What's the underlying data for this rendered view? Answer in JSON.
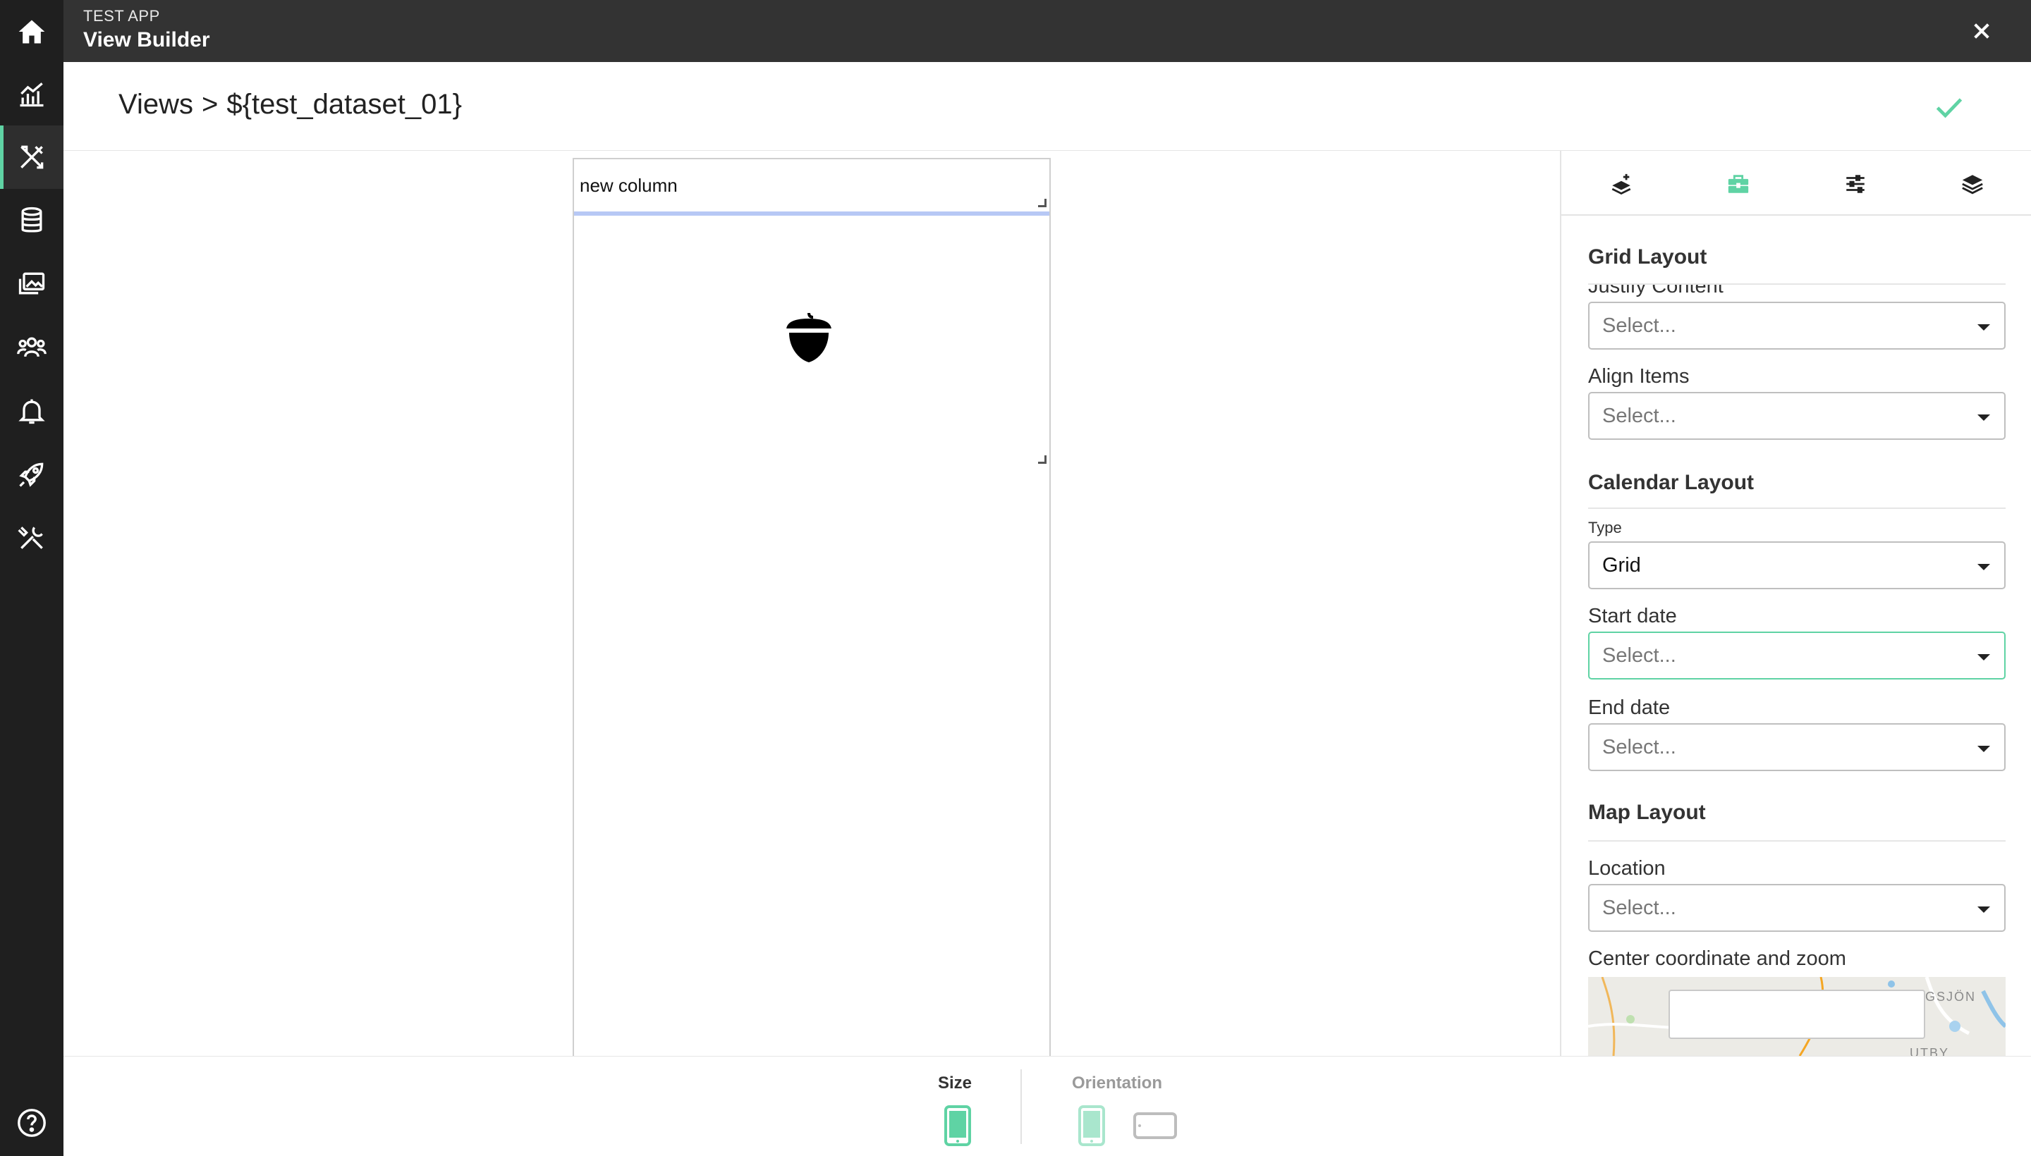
{
  "app": {
    "name": "TEST APP",
    "title": "View Builder"
  },
  "breadcrumb": {
    "root": "Views",
    "separator": ">",
    "current": "${test_dataset_01}"
  },
  "canvas": {
    "column_label": "new column"
  },
  "bottom_bar": {
    "size_label": "Size",
    "orientation_label": "Orientation"
  },
  "panel": {
    "tabs": [
      "layer-add-icon",
      "toolbox-icon",
      "sliders-icon",
      "layers-icon"
    ],
    "grid_layout": {
      "title": "Grid Layout",
      "justify_content_label": "Justify Content",
      "justify_content_value": "Select...",
      "align_items_label": "Align Items",
      "align_items_value": "Select..."
    },
    "calendar_layout": {
      "title": "Calendar Layout",
      "type_label": "Type",
      "type_value": "Grid",
      "start_date_label": "Start date",
      "start_date_value": "Select...",
      "end_date_label": "End date",
      "end_date_value": "Select..."
    },
    "map_layout": {
      "title": "Map Layout",
      "location_label": "Location",
      "location_value": "Select...",
      "center_label": "Center coordinate and zoom",
      "map_text_1": "GSJÖN",
      "map_text_2": "UTBY"
    }
  },
  "colors": {
    "accent": "#5fd3a4",
    "nav_bg": "#1f1f1f",
    "topbar_bg": "#333333",
    "column_underline": "#b7c8f5"
  },
  "nav_icons": [
    "home-icon",
    "analytics-icon",
    "view-builder-icon",
    "database-icon",
    "gallery-icon",
    "users-icon",
    "bell-icon",
    "rocket-icon",
    "tools-icon",
    "help-icon"
  ]
}
